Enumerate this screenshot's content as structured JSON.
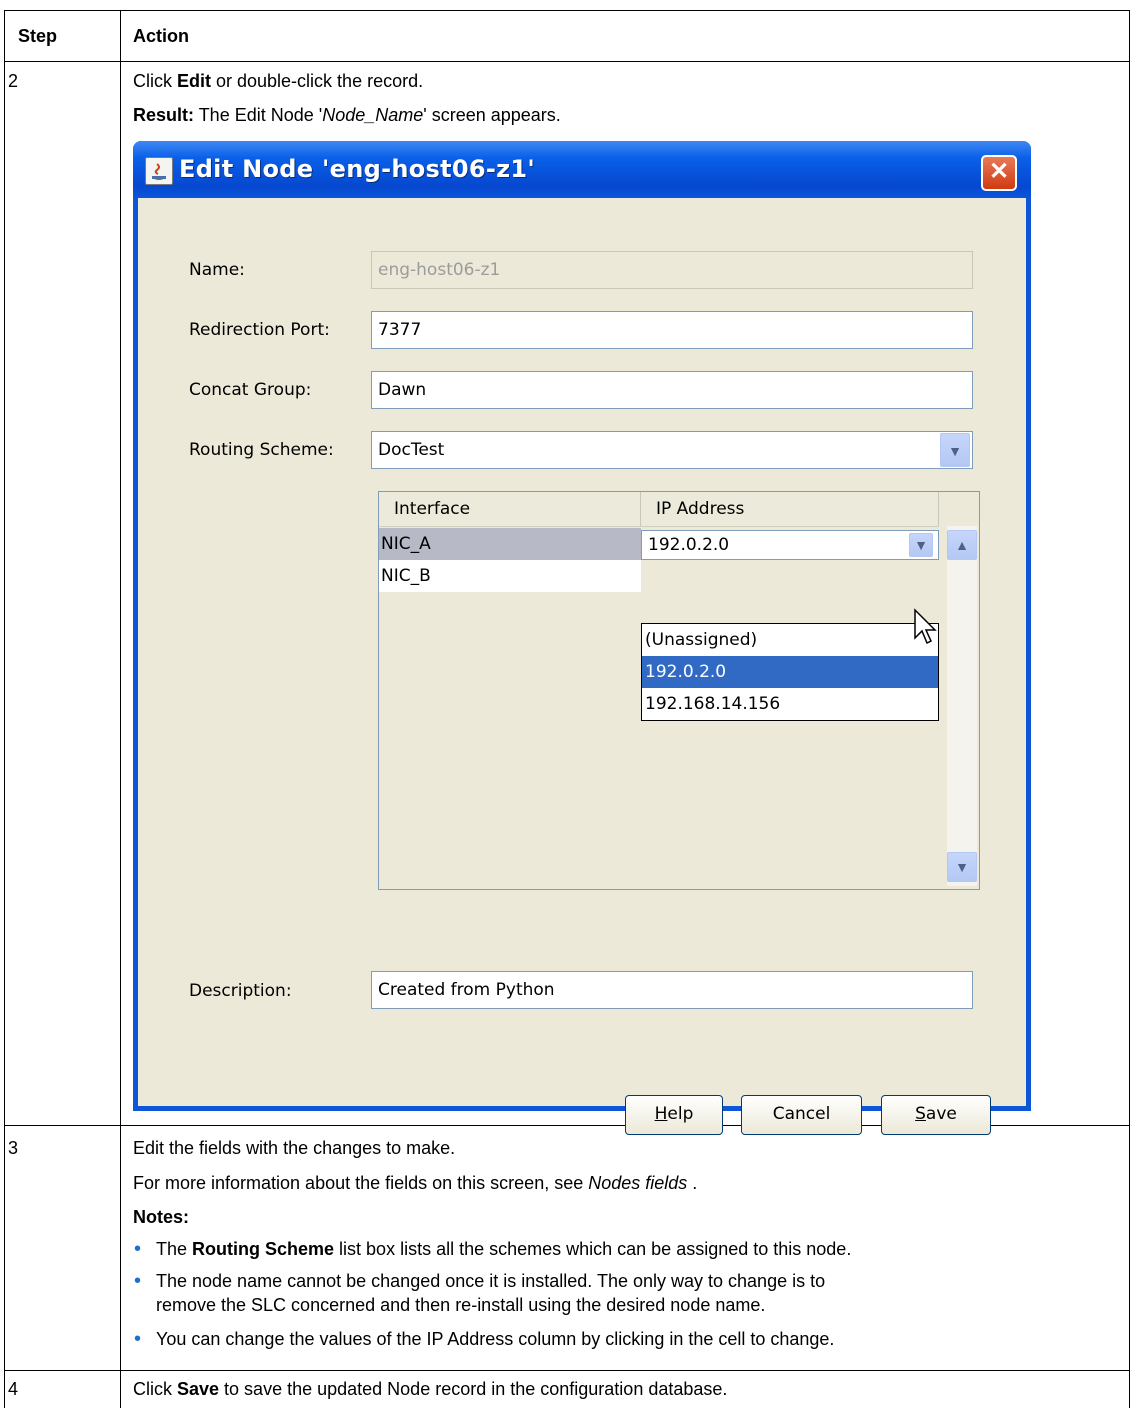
{
  "table": {
    "header": {
      "step": "Step",
      "action": "Action"
    },
    "rows": [
      {
        "step": "2",
        "line1": {
          "prefix": "Click ",
          "bold": "Edit",
          "suffix": " or double-click the record."
        },
        "line2": {
          "bold": "Result:",
          "prefix": " The Edit Node '",
          "italic": "Node_Name",
          "suffix": "' screen appears."
        }
      },
      {
        "step": "3",
        "line1": "Edit the fields with the changes to make.",
        "line2": {
          "prefix": "For more information about the fields on this screen, see ",
          "italic": "Nodes fields",
          "suffix": " ."
        },
        "notes_label": "Notes:",
        "bullets": [
          {
            "prefix": "The ",
            "bold": "Routing Scheme",
            "suffix": " list box lists all the schemes which can be assigned to this node."
          },
          {
            "line1": "The node name cannot be changed once it is installed. The only way to change is to",
            "line2": "remove the SLC concerned and then re-install using the desired node name."
          },
          {
            "text": "You can change the values of the IP Address column by clicking in the cell to change."
          }
        ]
      },
      {
        "step": "4",
        "line1": {
          "prefix": "Click ",
          "bold": "Save",
          "suffix": " to save the updated Node record in the configuration database."
        }
      }
    ]
  },
  "dialog": {
    "title": "Edit Node 'eng-host06-z1'",
    "close": "✕",
    "fields": {
      "name_label": "Name:",
      "name_value": "eng-host06-z1",
      "port_label": "Redirection Port:",
      "port_value": "7377",
      "group_label": "Concat Group:",
      "group_value": "Dawn",
      "scheme_label": "Routing Scheme:",
      "scheme_value": "DocTest",
      "desc_label": "Description:",
      "desc_value": "Created from Python"
    },
    "grid": {
      "headers": [
        "Interface",
        "IP Address"
      ],
      "rows": [
        {
          "interface": "NIC_A",
          "ip": "192.0.2.0"
        },
        {
          "interface": "NIC_B",
          "ip": ""
        }
      ],
      "dropdown_options": [
        "(Unassigned)",
        "192.0.2.0",
        "192.168.14.156"
      ],
      "dropdown_selected": "192.0.2.0"
    },
    "buttons": {
      "help_mnemonic": "H",
      "help_rest": "elp",
      "cancel": "Cancel",
      "save_mnemonic": "S",
      "save_rest": "ave"
    }
  }
}
